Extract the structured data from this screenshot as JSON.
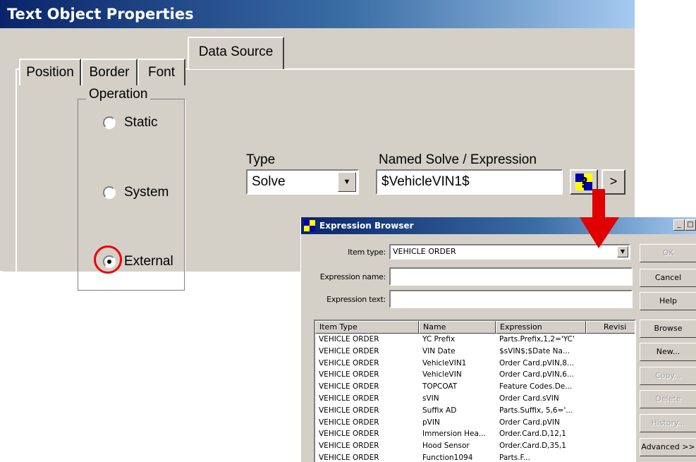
{
  "dialog": {
    "title": "Text Object Properties",
    "tabs": [
      "Position",
      "Border",
      "Font",
      "Data Source"
    ],
    "active_tab": "Data Source",
    "operation": {
      "legend": "Operation",
      "options": [
        "Static",
        "System",
        "External"
      ],
      "selected": "External"
    },
    "type": {
      "label": "Type",
      "value": "Solve"
    },
    "expression": {
      "label": "Named Solve / Expression",
      "value": "$VehicleVIN1$",
      "more_button": ">"
    }
  },
  "annotation_color": "#e00000",
  "browser": {
    "title": "Expression Browser",
    "window_buttons": {
      "minimize": "_",
      "maximize": "□"
    },
    "item_type": {
      "label": "Item type:",
      "value": "VEHICLE ORDER"
    },
    "expression_name": {
      "label": "Expression name:",
      "value": ""
    },
    "expression_text": {
      "label": "Expression text:",
      "value": ""
    },
    "buttons": [
      {
        "label": "OK",
        "enabled": false
      },
      {
        "label": "Cancel",
        "enabled": true
      },
      {
        "label": "Help",
        "enabled": true
      },
      {
        "label": "Browse",
        "enabled": true
      },
      {
        "label": "New...",
        "enabled": true
      },
      {
        "label": "Copy...",
        "enabled": false
      },
      {
        "label": "Delete",
        "enabled": false
      },
      {
        "label": "History...",
        "enabled": false
      },
      {
        "label": "Advanced >>",
        "enabled": true
      }
    ],
    "columns": [
      "Item Type",
      "Name",
      "Expression",
      "Revisi"
    ],
    "rows": [
      [
        "VEHICLE ORDER",
        "YC Prefix",
        "Parts.Prefix,1,2='YC'"
      ],
      [
        "VEHICLE ORDER",
        "VIN Date",
        "$sVIN$;$Date Na..."
      ],
      [
        "VEHICLE ORDER",
        "VehicleVIN1",
        "Order Card.pVIN,8..."
      ],
      [
        "VEHICLE ORDER",
        "VehicleVIN",
        "Order Card.pVIN,6..."
      ],
      [
        "VEHICLE ORDER",
        "TOPCOAT",
        "Feature Codes.De..."
      ],
      [
        "VEHICLE ORDER",
        "sVIN",
        "Order Card.sVIN"
      ],
      [
        "VEHICLE ORDER",
        "Suffix AD",
        "Parts.Suffix, 5,6='..."
      ],
      [
        "VEHICLE ORDER",
        "pVIN",
        "Order Card.pVIN"
      ],
      [
        "VEHICLE ORDER",
        "Immersion Hea...",
        "Order.Card.D,12,1"
      ],
      [
        "VEHICLE ORDER",
        "Hood Sensor",
        "Order.Card.D,35,1"
      ],
      [
        "VEHICLE ORDER",
        "Function1094",
        "Parts.F..."
      ]
    ]
  }
}
